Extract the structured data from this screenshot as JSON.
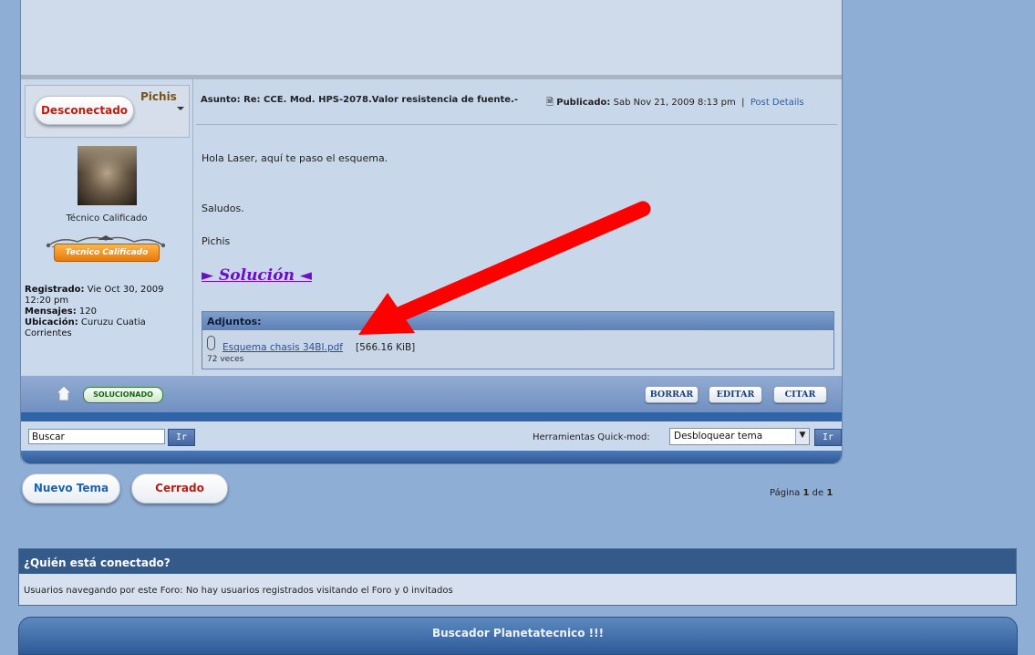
{
  "profile": {
    "status_button": "Desconectado",
    "username": "Pichis",
    "rank": "Técnico Calificado",
    "rank_badge": "Tecnico Calificado",
    "registered_label": "Registrado:",
    "registered_value": "Vie Oct 30, 2009 12:20 pm",
    "posts_label": "Mensajes:",
    "posts_value": "120",
    "location_label": "Ubicación:",
    "location_value": "Curuzu Cuatia Corrientes"
  },
  "post": {
    "subject_label": "Asunto:",
    "subject": "Re: CCE. Mod. HPS-2078.Valor resistencia de fuente.-",
    "published_label": "Publicado:",
    "published_value": "Sab Nov 21, 2009 8:13 pm",
    "separator": "|",
    "details_link": "Post Details",
    "line1": "Hola Laser, aquí te paso el esquema.",
    "line2": "Saludos.",
    "line3": "Pichis",
    "solution_link": "► Solución ◄"
  },
  "attachments": {
    "title": "Adjuntos:",
    "file_name": "Esquema chasis 34BI.pdf",
    "file_size": "[566.16 KiB]",
    "downloads": "72 veces"
  },
  "actions": {
    "solved": "SOLUCIONADO",
    "delete": "BORRAR",
    "edit": "EDITAR",
    "quote": "CITAR"
  },
  "tools": {
    "search_value": "Buscar",
    "go": "Ir",
    "quickmod_label": "Herramientas Quick-mod:",
    "quickmod_selected": "Desbloquear tema"
  },
  "buttons": {
    "new_topic": "Nuevo Tema",
    "closed": "Cerrado"
  },
  "pagination": {
    "prefix": "Página",
    "current": "1",
    "of": "de",
    "total": "1"
  },
  "online": {
    "title": "¿Quién está conectado?",
    "text": "Usuarios navegando por este Foro: No hay usuarios registrados visitando el Foro y 0 invitados"
  },
  "footer": {
    "title": "Buscador Planetatecnico !!!"
  },
  "colors": {
    "page_bg": "#8eaed6",
    "header_blue": "#345a8a",
    "annotation_arrow": "#ff0000"
  }
}
